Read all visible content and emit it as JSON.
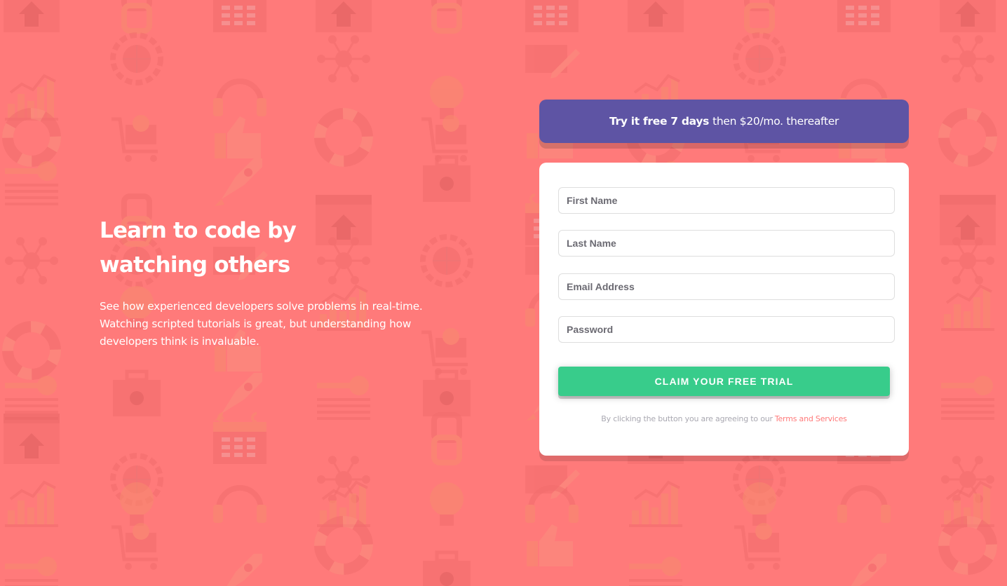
{
  "colors": {
    "background": "#ff7a7a",
    "pattern_icon": "#f26d6d",
    "promo_bg": "#5e54a4",
    "cta_bg": "#38cc8b",
    "terms_link": "#ff7a7a"
  },
  "hero": {
    "title": "Learn to code by watching others",
    "description": "See how experienced developers solve problems in real-time. Watching scripted tutorials is great, but understanding how developers think is invaluable."
  },
  "promo": {
    "bold_text": "Try it free 7 days",
    "rest_text": "then $20/mo. thereafter"
  },
  "form": {
    "first_name": {
      "placeholder": "First Name",
      "value": ""
    },
    "last_name": {
      "placeholder": "Last Name",
      "value": ""
    },
    "email": {
      "placeholder": "Email Address",
      "value": ""
    },
    "password": {
      "placeholder": "Password",
      "value": ""
    },
    "submit_label": "CLAIM YOUR FREE TRIAL",
    "terms_text": "By clicking the button you are agreeing to our",
    "terms_link": "Terms and Services"
  },
  "background_icons": [
    "browser-window-icon",
    "headset-icon",
    "toolbox-icon",
    "network-icon",
    "thumbs-up-icon",
    "link-icon",
    "chart-icon",
    "rocket-icon",
    "globe-gear-icon",
    "lifebuoy-icon",
    "calendar-icon",
    "lightbulb-icon",
    "key-icon",
    "pencil-icon",
    "cart-icon"
  ]
}
